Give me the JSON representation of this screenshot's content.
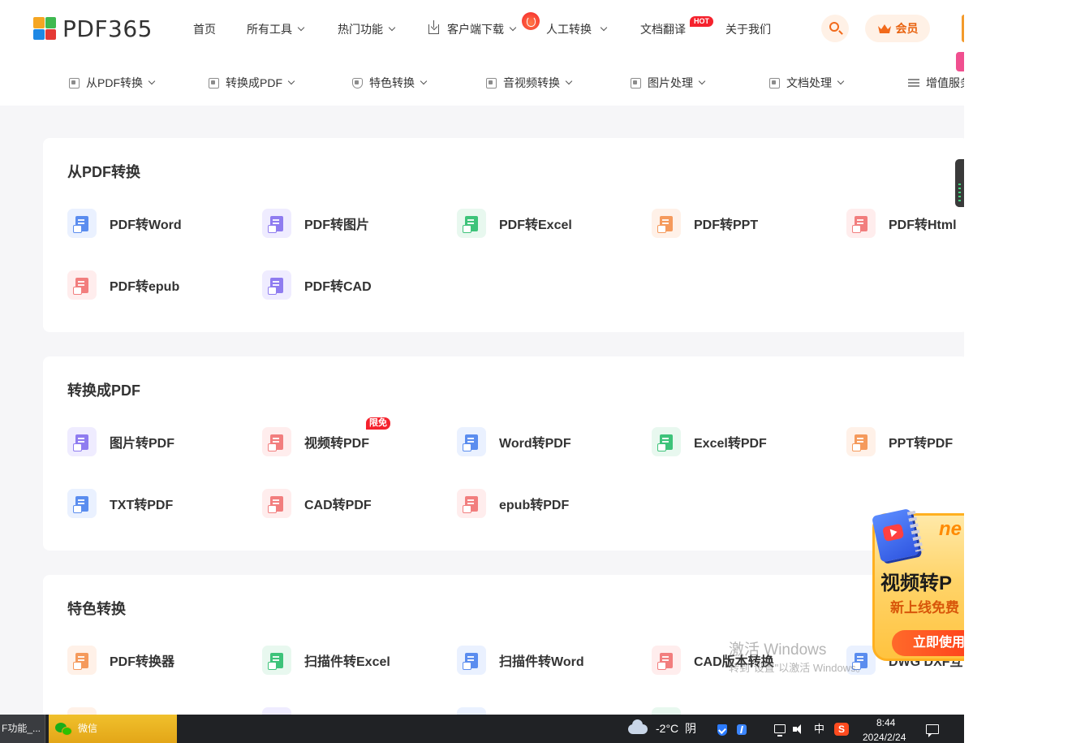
{
  "brand": {
    "name": "PDF365",
    "logo_colors": [
      "#f5a623",
      "#3fb950",
      "#1e88e5",
      "#e53935"
    ]
  },
  "header": {
    "nav": [
      {
        "label": "首页",
        "has_caret": false
      },
      {
        "label": "所有工具",
        "has_caret": true
      },
      {
        "label": "热门功能",
        "has_caret": true
      },
      {
        "label": "客户端下载",
        "has_caret": true,
        "icon": "download-icon"
      },
      {
        "label": "人工转换",
        "has_caret": true,
        "icon": "fire-icon"
      },
      {
        "label": "文档翻译",
        "has_caret": false,
        "badge": "HOT"
      },
      {
        "label": "关于我们",
        "has_caret": false
      }
    ],
    "search_icon": "search-icon",
    "vip_label": "会员"
  },
  "subnav": {
    "items": [
      {
        "label": "从PDF转换",
        "icon": "pdf-export-icon"
      },
      {
        "label": "转换成PDF",
        "icon": "pdf-import-icon"
      },
      {
        "label": "特色转换",
        "icon": "shield-icon"
      },
      {
        "label": "音视频转换",
        "icon": "media-icon"
      },
      {
        "label": "图片处理",
        "icon": "image-icon"
      },
      {
        "label": "文档处理",
        "icon": "document-icon"
      },
      {
        "label": "增值服务",
        "icon": "list-icon"
      }
    ]
  },
  "sections": [
    {
      "title": "从PDF转换",
      "tools": [
        {
          "label": "PDF转Word",
          "color": "#5b8def",
          "bg": "#eaf1ff"
        },
        {
          "label": "PDF转图片",
          "color": "#8f7cf0",
          "bg": "#efecff"
        },
        {
          "label": "PDF转Excel",
          "color": "#3ec37a",
          "bg": "#e8f8ef"
        },
        {
          "label": "PDF转PPT",
          "color": "#f59a5c",
          "bg": "#fff1e8"
        },
        {
          "label": "PDF转Html",
          "color": "#f27e7e",
          "bg": "#ffeded"
        },
        {
          "label": "PDF转epub",
          "color": "#f27e7e",
          "bg": "#ffeded"
        },
        {
          "label": "PDF转CAD",
          "color": "#8f7cf0",
          "bg": "#efecff"
        }
      ]
    },
    {
      "title": "转换成PDF",
      "tools": [
        {
          "label": "图片转PDF",
          "color": "#8f7cf0",
          "bg": "#efecff"
        },
        {
          "label": "视频转PDF",
          "color": "#f27e7e",
          "bg": "#ffeded",
          "badge": "限免"
        },
        {
          "label": "Word转PDF",
          "color": "#5b8def",
          "bg": "#eaf1ff"
        },
        {
          "label": "Excel转PDF",
          "color": "#3ec37a",
          "bg": "#e8f8ef"
        },
        {
          "label": "PPT转PDF",
          "color": "#f59a5c",
          "bg": "#fff1e8"
        },
        {
          "label": "TXT转PDF",
          "color": "#5b8def",
          "bg": "#eaf1ff"
        },
        {
          "label": "CAD转PDF",
          "color": "#f27e7e",
          "bg": "#ffeded"
        },
        {
          "label": "epub转PDF",
          "color": "#f27e7e",
          "bg": "#ffeded"
        }
      ]
    },
    {
      "title": "特色转换",
      "tools": [
        {
          "label": "PDF转换器",
          "color": "#f59a5c",
          "bg": "#fff1e8"
        },
        {
          "label": "扫描件转Excel",
          "color": "#3ec37a",
          "bg": "#e8f8ef"
        },
        {
          "label": "扫描件转Word",
          "color": "#5b8def",
          "bg": "#eaf1ff"
        },
        {
          "label": "CAD版本转换",
          "color": "#f27e7e",
          "bg": "#ffeded"
        },
        {
          "label": "DWG DXF互",
          "color": "#5b8def",
          "bg": "#eaf1ff"
        }
      ]
    }
  ],
  "promo": {
    "tag": "ne",
    "title": "视频转P",
    "subtitle": "新上线免费",
    "button": "立即使用"
  },
  "watermark": {
    "line1": "激活 Windows",
    "line2": "转到\"设置\"以激活 Windows。"
  },
  "taskbar": {
    "task1": "F功能_...",
    "task2": "微信",
    "weather_temp": "-2°C",
    "weather_desc": "阴",
    "ime": "中",
    "sogou": "S",
    "time": "8:44",
    "date": "2024/2/24"
  }
}
